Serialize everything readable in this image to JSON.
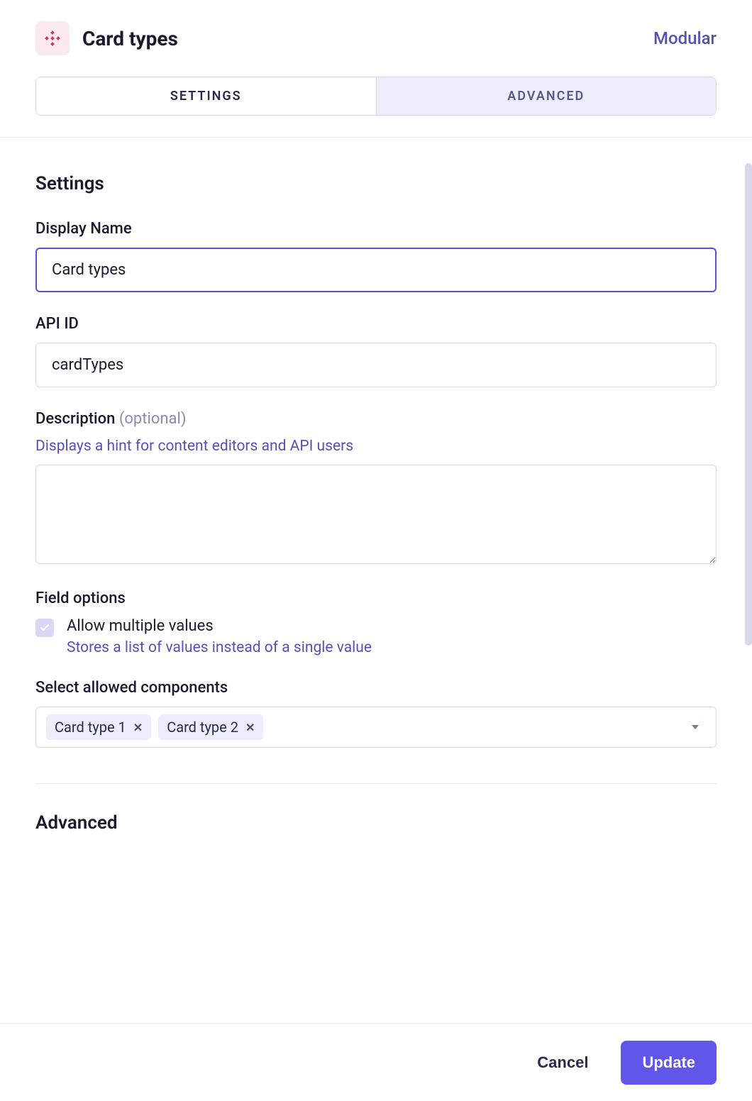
{
  "header": {
    "title": "Card types",
    "field_type": "Modular"
  },
  "tabs": {
    "settings": "SETTINGS",
    "advanced": "ADVANCED"
  },
  "settings": {
    "heading": "Settings",
    "display_name": {
      "label": "Display Name",
      "value": "Card types"
    },
    "api_id": {
      "label": "API ID",
      "value": "cardTypes"
    },
    "description": {
      "label": "Description",
      "optional": "(optional)",
      "hint": "Displays a hint for content editors and API users",
      "value": ""
    },
    "field_options": {
      "label": "Field options",
      "allow_multiple": {
        "label": "Allow multiple values",
        "desc": "Stores a list of values instead of a single value",
        "checked": true
      }
    },
    "allowed_components": {
      "label": "Select allowed components",
      "selected": [
        "Card type 1",
        "Card type 2"
      ]
    }
  },
  "advanced": {
    "heading": "Advanced"
  },
  "footer": {
    "cancel": "Cancel",
    "update": "Update"
  }
}
